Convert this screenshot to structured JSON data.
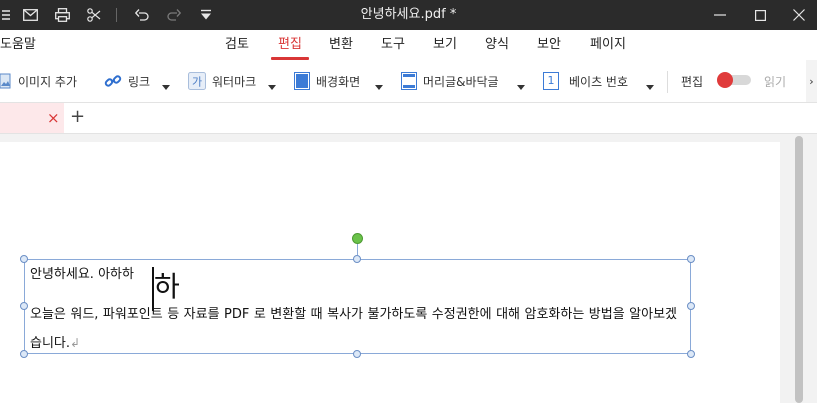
{
  "window": {
    "title": "안녕하세요.pdf *"
  },
  "quick_access": {
    "icons": [
      "menu-icon",
      "mail-icon",
      "print-icon",
      "scissors-icon",
      "undo-icon",
      "redo-icon",
      "dropdown-icon"
    ]
  },
  "menu": {
    "help": "도움말",
    "items": [
      {
        "label": "검토",
        "active": false
      },
      {
        "label": "편집",
        "active": true
      },
      {
        "label": "변환",
        "active": false
      },
      {
        "label": "도구",
        "active": false
      },
      {
        "label": "보기",
        "active": false
      },
      {
        "label": "양식",
        "active": false
      },
      {
        "label": "보안",
        "active": false
      },
      {
        "label": "페이지",
        "active": false
      }
    ]
  },
  "toolbar": {
    "image_add": "이미지 추가",
    "link": "링크",
    "watermark": "워터마크",
    "background": "배경화면",
    "header_footer": "머리글&바닥글",
    "bates_number": "베이츠 번호",
    "bates_icon_text": "1",
    "edit": "편집",
    "read": "읽기",
    "more": "›"
  },
  "tabs": {
    "close": "×",
    "add": "+"
  },
  "document": {
    "line1": "안녕하세요. 아하하",
    "ime_char": "하",
    "paragraph": "오늘은 워드, 파워포인트 등 자료를 PDF 로 변환할 때 복사가 불가하도록 수정권한에 대해 암호화하는 방법을 알아보겠습니다.",
    "para_mark": "↲"
  },
  "colors": {
    "accent": "#d93636",
    "titlebar": "#2b2b2b",
    "selection": "#8aa9d8",
    "rotate_handle": "#6ac24a"
  }
}
